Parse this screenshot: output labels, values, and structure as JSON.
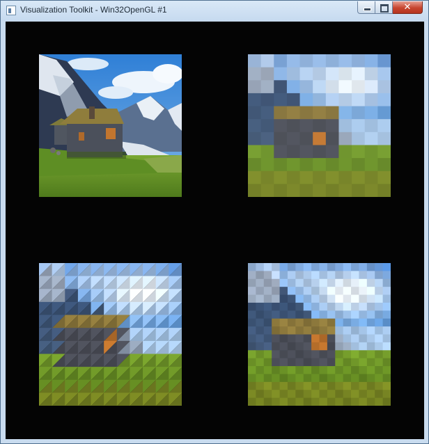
{
  "window": {
    "title": "Visualization Toolkit - Win32OpenGL #1",
    "close_glyph": "✕",
    "icons": {
      "app": "vtk-window-icon",
      "minimize": "minimize-icon",
      "maximize": "maximize-icon",
      "close": "close-icon"
    }
  },
  "colors": {
    "canvas_background": "#040404",
    "titlebar": "#c9dcef",
    "close_button": "#c7452f",
    "sky": "#3f8fe0",
    "cloud": "#e8f2fb",
    "mountain": "#2e3a52",
    "snow": "#e6ecf4",
    "grass": "#6f9a2a",
    "roof": "#8a7a3a",
    "cabin": "#4a4e58"
  },
  "views": [
    {
      "id": "original",
      "description_icon": "image-original"
    },
    {
      "id": "blurred-quads",
      "description_icon": "image-resampled-quads"
    },
    {
      "id": "triangulated",
      "description_icon": "image-resampled-triangles"
    },
    {
      "id": "pixelated",
      "description_icon": "image-resampled-pixels"
    }
  ]
}
